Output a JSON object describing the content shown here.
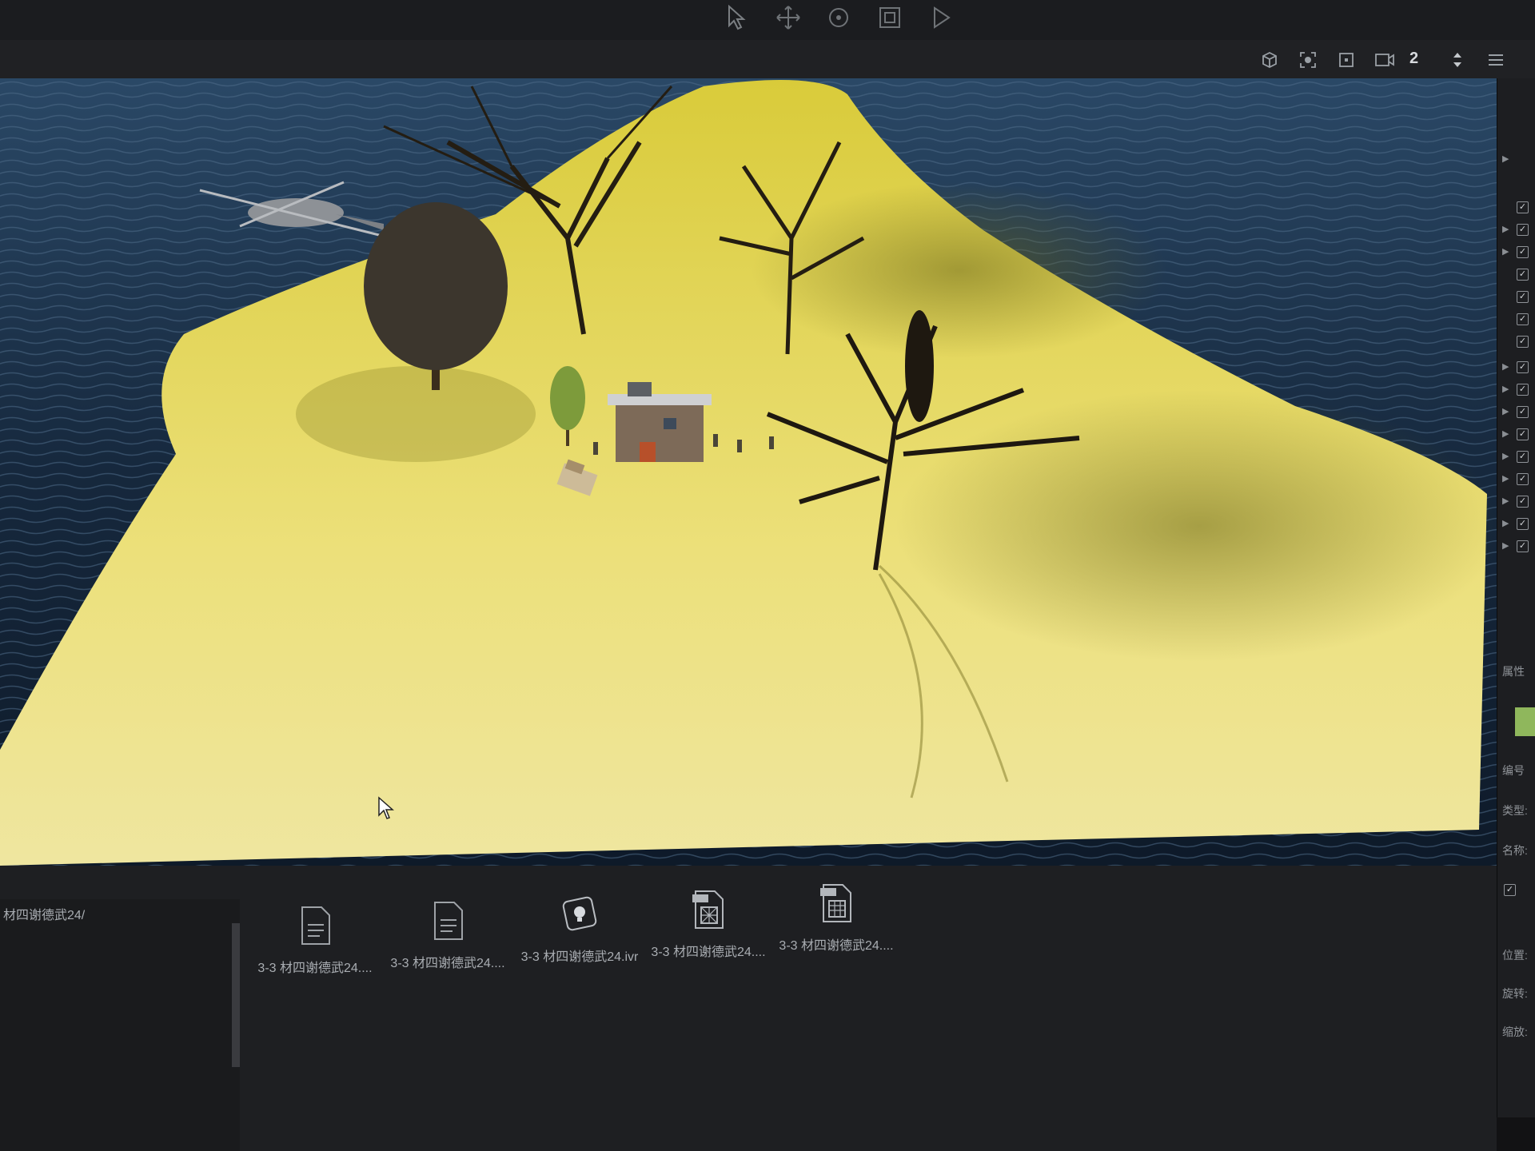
{
  "toolbar": {
    "tools": [
      {
        "name": "select-tool",
        "icon": "cursor-arrow-icon"
      },
      {
        "name": "move-tool",
        "icon": "move-arrows-icon"
      },
      {
        "name": "rotate-tool",
        "icon": "rotate-icon"
      },
      {
        "name": "scale-tool",
        "icon": "scale-box-icon"
      },
      {
        "name": "play-tool",
        "icon": "play-icon"
      }
    ]
  },
  "view_header": {
    "camera_number": "2",
    "icons": [
      "cube-view-icon",
      "focus-icon",
      "frame-icon",
      "camera-icon",
      "spinner-icon",
      "menu-icon"
    ]
  },
  "scene": {
    "colors": {
      "sea": "#17304a",
      "terrain": "#e6d84a",
      "shadow": "#8f8a2c",
      "tree": "#2a2418"
    }
  },
  "properties": {
    "header": "属性",
    "id_label": "编号",
    "type_label": "类型:",
    "name_label": "名称:",
    "position_label": "位置:",
    "rotation_label": "旋转:",
    "scale_label": "缩放:"
  },
  "assets": {
    "path": "材四谢德武24/",
    "items": [
      {
        "label": "3-3 材四谢德武24....",
        "icon": "document-icon"
      },
      {
        "label": "3-3 材四谢德武24....",
        "icon": "document-icon"
      },
      {
        "label": "3-3 材四谢德武24.ivr",
        "icon": "scene-bulb-icon"
      },
      {
        "label": "3-3 材四谢德武24....",
        "icon": "png-file-icon"
      },
      {
        "label": "3-3 材四谢德武24....",
        "icon": "image-file-icon"
      }
    ]
  }
}
